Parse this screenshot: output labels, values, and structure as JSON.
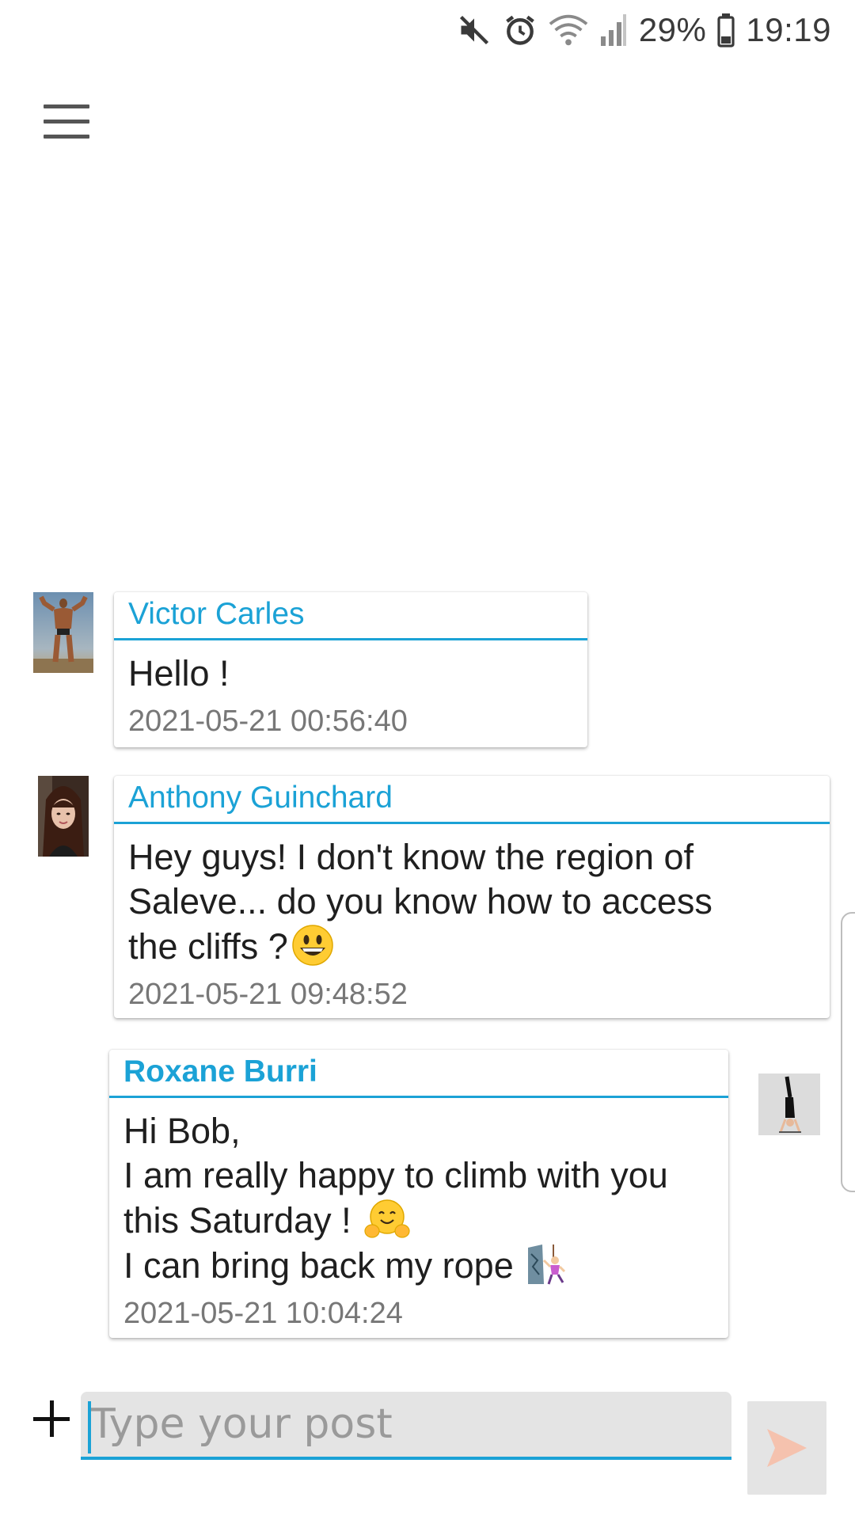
{
  "status_bar": {
    "battery_percent": "29%",
    "time": "19:19",
    "icons": [
      "mute-icon",
      "alarm-icon",
      "wifi-icon",
      "signal-icon",
      "battery-icon"
    ]
  },
  "app_bar": {
    "menu_icon": "hamburger-menu-icon"
  },
  "messages": [
    {
      "author": "Victor Carles",
      "lines": [
        "Hello !"
      ],
      "timestamp": "2021-05-21 00:56:40",
      "avatar": "bodybuilder-photo",
      "own": false
    },
    {
      "author": "Anthony Guinchard",
      "lines": [
        "Hey guys! I don't know the region of",
        "Saleve... do you know how to access",
        "the cliffs ?"
      ],
      "emoji": "grinning-face-emoji",
      "timestamp": "2021-05-21 09:48:52",
      "avatar": "woman-selfie-photo",
      "own": false
    },
    {
      "author": "Roxane Burri",
      "lines": [
        "Hi Bob,",
        "I am really happy to climb with you",
        "this Saturday ! ",
        "I can bring back my rope "
      ],
      "emojis": [
        "hugging-face-emoji",
        "woman-climbing-emoji"
      ],
      "timestamp": "2021-05-21 10:04:24",
      "avatar": "handstand-photo",
      "own": true
    }
  ],
  "composer": {
    "add_label": "+",
    "placeholder": "Type your post",
    "send_icon": "send-arrow-icon"
  },
  "colors": {
    "accent": "#1ba2d6",
    "send_arrow": "#f5c2ae",
    "input_bg": "#e4e4e4"
  }
}
